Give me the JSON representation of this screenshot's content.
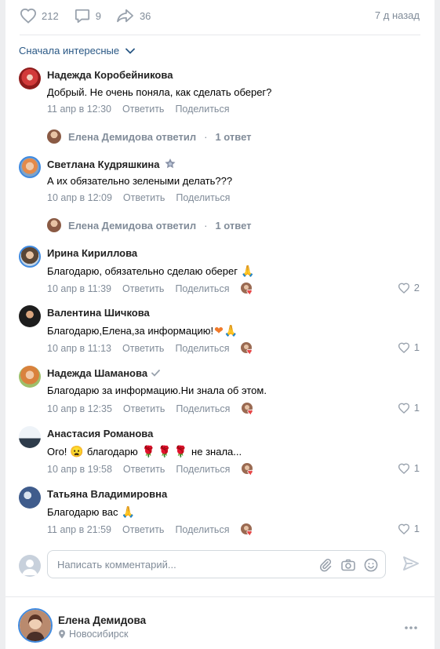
{
  "post": {
    "likes": "212",
    "comments": "9",
    "shares": "36",
    "age": "7 д назад"
  },
  "sort_label": "Сначала интересные",
  "actions": {
    "reply": "Ответить",
    "share": "Поделиться"
  },
  "comments": [
    {
      "author": "Надежда Коробейникова",
      "text": "Добрый. Не очень поняла, как сделать оберег?",
      "date": "11 апр в 12:30",
      "likes": ""
    },
    {
      "author": "Светлана Кудряшкина",
      "text": "А их обязательно зелеными делать???",
      "date": "10 апр в 12:09",
      "likes": ""
    },
    {
      "author": "Ирина Кириллова",
      "text": "Благодарю, обязательно сделаю оберег",
      "date": "10 апр в 11:39",
      "likes": "2"
    },
    {
      "author": "Валентина Шичкова",
      "text": "Благодарю,Елена,за информацию!",
      "date": "10 апр в 11:13",
      "likes": "1"
    },
    {
      "author": "Надежда Шаманова",
      "text": "Благодарю за информацию.Ни знала об этом.",
      "date": "10 апр в 12:35",
      "likes": "1"
    },
    {
      "author": "Анастасия Романова",
      "text_before": "Ого!",
      "text_mid": "благодарю",
      "text_after": "не знала...",
      "date": "10 апр в 19:58",
      "likes": "1"
    },
    {
      "author": "Татьяна Владимировна",
      "text": "Благодарю вас",
      "date": "11 апр в 21:59",
      "likes": "1"
    }
  ],
  "threads": [
    {
      "who": "Елена Демидова ответил",
      "count": "1 ответ"
    },
    {
      "who": "Елена Демидова ответил",
      "count": "1 ответ"
    }
  ],
  "composer": {
    "placeholder": "Написать комментарий..."
  },
  "profile": {
    "name": "Елена Демидова",
    "location": "Новосибирск"
  },
  "colors": {
    "accent": "#2a5885",
    "muted": "#818c99",
    "heart": "#e64646"
  }
}
